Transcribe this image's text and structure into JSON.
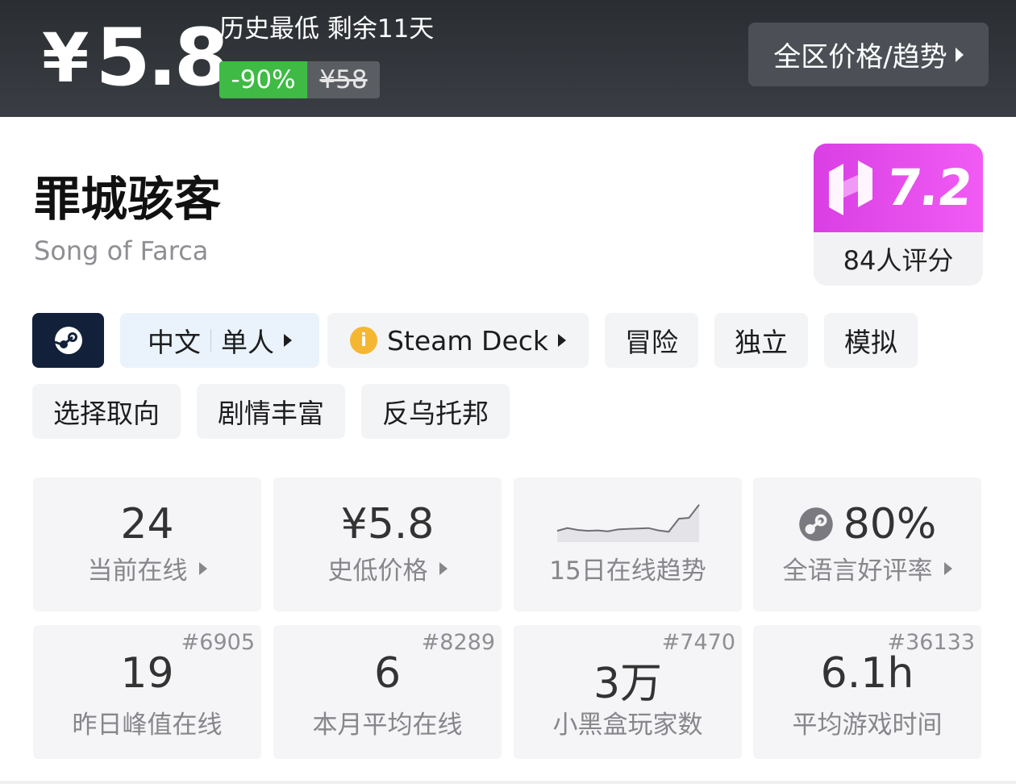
{
  "banner": {
    "currency": "¥",
    "price": "5.8",
    "deal_title": "历史最低 剩余11天",
    "discount": "-90%",
    "original_price": "¥58",
    "region_button": "全区价格/趋势"
  },
  "game": {
    "title": "罪城骇客",
    "subtitle": "Song of Farca"
  },
  "score": {
    "value": "7.2",
    "raters": "84人评分",
    "accent": "#e64cf0"
  },
  "tags": {
    "lang": "中文",
    "mode": "单人",
    "steam_deck": "Steam Deck",
    "info_glyph": "i",
    "genres": [
      "冒险",
      "独立",
      "模拟"
    ],
    "themes": [
      "选择取向",
      "剧情丰富",
      "反乌托邦"
    ]
  },
  "stats_top": [
    {
      "value": "24",
      "label": "当前在线"
    },
    {
      "value": "¥5.8",
      "label": "史低价格"
    },
    {
      "value": "",
      "label": "15日在线趋势"
    },
    {
      "value": "80%",
      "label": "全语言好评率"
    }
  ],
  "stats_bottom": [
    {
      "rank": "#6905",
      "value": "19",
      "label": "昨日峰值在线"
    },
    {
      "rank": "#8289",
      "value": "6",
      "label": "本月平均在线"
    },
    {
      "rank": "#7470",
      "value": "3万",
      "label": "小黑盒玩家数"
    },
    {
      "rank": "#36133",
      "value": "6.1h",
      "label": "平均游戏时间"
    }
  ],
  "chart_data": {
    "type": "line",
    "x": [
      1,
      2,
      3,
      4,
      5,
      6,
      7,
      8,
      9,
      10,
      11,
      12,
      13,
      14,
      15
    ],
    "series": [
      {
        "values": [
          24,
          30,
          26,
          24,
          25,
          23,
          27,
          28,
          29,
          30,
          25,
          22,
          50,
          52,
          80
        ]
      }
    ],
    "ylim": [
      0,
      90
    ],
    "grid": false,
    "stroke": "#6e6e73",
    "fill": "#e4e4e8"
  }
}
